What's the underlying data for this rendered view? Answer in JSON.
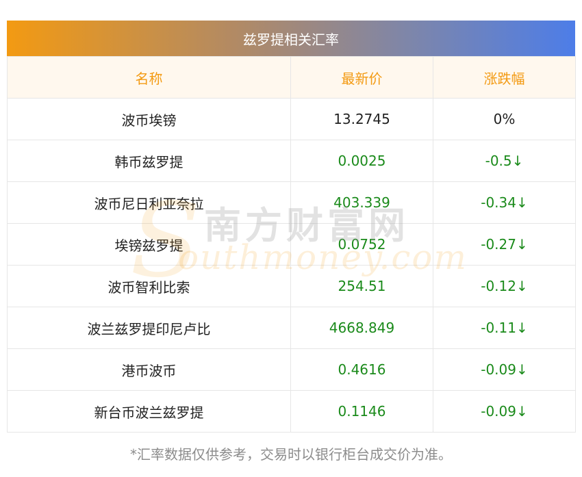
{
  "title": "兹罗提相关汇率",
  "columns": [
    "名称",
    "最新价",
    "涨跌幅"
  ],
  "rows": [
    {
      "name": "波币埃镑",
      "price": "13.2745",
      "change": "0%",
      "direction": "flat"
    },
    {
      "name": "韩币兹罗提",
      "price": "0.0025",
      "change": "-0.5↓",
      "direction": "down"
    },
    {
      "name": "波币尼日利亚奈拉",
      "price": "403.339",
      "change": "-0.34↓",
      "direction": "down"
    },
    {
      "name": "埃镑兹罗提",
      "price": "0.0752",
      "change": "-0.27↓",
      "direction": "down"
    },
    {
      "name": "波币智利比索",
      "price": "254.51",
      "change": "-0.12↓",
      "direction": "down"
    },
    {
      "name": "波兰兹罗提印尼卢比",
      "price": "4668.849",
      "change": "-0.11↓",
      "direction": "down"
    },
    {
      "name": "港币波币",
      "price": "0.4616",
      "change": "-0.09↓",
      "direction": "down"
    },
    {
      "name": "新台币波兰兹罗提",
      "price": "0.1146",
      "change": "-0.09↓",
      "direction": "down"
    }
  ],
  "footnote": "*汇率数据仅供参考，交易时以银行柜台成交价为准。",
  "watermark": {
    "cn": "南方财富网",
    "en": "outhmoney.com",
    "letter": "S"
  },
  "colors": {
    "header_text": "#f39a12",
    "down": "#1a8a1a",
    "neutral": "#222222"
  }
}
